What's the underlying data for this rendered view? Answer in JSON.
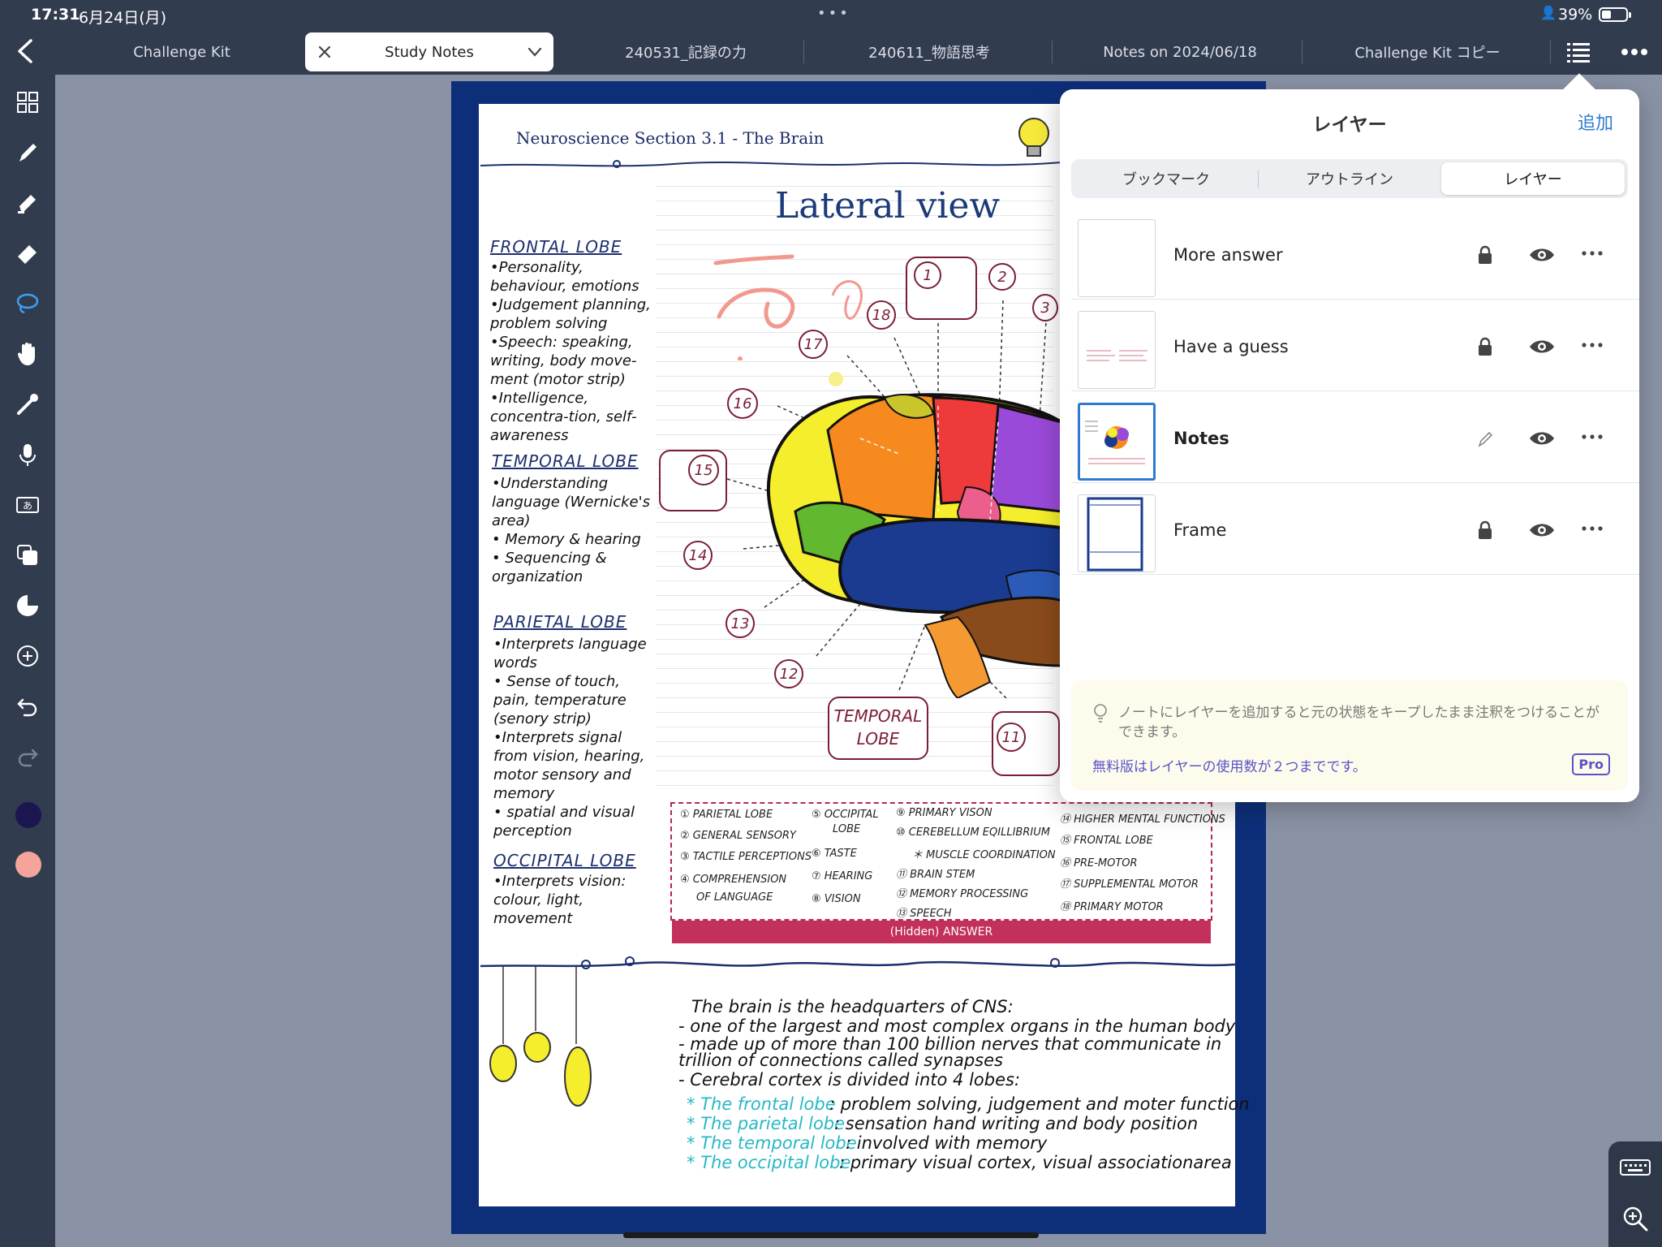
{
  "status": {
    "time": "17:31",
    "date": "6月24日(月)",
    "battery_pct": "39%",
    "battery_level": 0.39
  },
  "tabs": [
    {
      "label": "Challenge Kit"
    },
    {
      "label": "Study Notes"
    },
    {
      "label": "240531_記録の力"
    },
    {
      "label": "240611_物語思考"
    },
    {
      "label": "Notes on 2024/06/18"
    },
    {
      "label": "Challenge Kit コピー"
    }
  ],
  "document": {
    "header": "Neuroscience Section 3.1 - The Brain",
    "diagram_title": "Lateral view",
    "sidebar": {
      "frontal_heading": "FRONTAL LOBE",
      "frontal_items": [
        "•Personality, behaviour, emotions",
        "•Judgement planning, problem solving",
        "•Speech: speaking, writing, body move-ment (motor strip)",
        "•Intelligence, concentra-tion, self-awareness"
      ],
      "temporal_heading": "TEMPORAL LOBE",
      "temporal_items": [
        "•Understanding language (Wernicke's area)",
        "• Memory & hearing",
        "• Sequencing & organization"
      ],
      "parietal_heading": "PARIETAL LOBE",
      "parietal_items": [
        "•Interprets language words",
        "• Sense of touch, pain, temperature (senory strip)",
        "•Interprets signal from vision, hearing, motor sensory and memory",
        "• spatial and visual perception"
      ],
      "occipital_heading": "OCCIPITAL LOBE",
      "occipital_items": [
        "•Interprets vision: colour, light, movement"
      ]
    },
    "labels": [
      "1",
      "2",
      "3",
      "11",
      "12",
      "13",
      "14",
      "15",
      "16",
      "17",
      "18"
    ],
    "temporal_box": [
      "TEMPORAL",
      "LOBE"
    ],
    "answers": {
      "col1": [
        "① PARIETAL LOBE",
        "② GENERAL SENSORY",
        "③ TACTILE PERCEPTIONS",
        "④ COMPREHENSION",
        "OF LANGUAGE"
      ],
      "col2": [
        "⑤ OCCIPITAL",
        "LOBE",
        "⑥ TASTE",
        "⑦ HEARING",
        "⑧ VISION"
      ],
      "col3": [
        "⑨ PRIMARY VISON",
        "⑩ CEREBELLUM EQILLIBRIUM",
        "＊ MUSCLE COORDINATION",
        "⑪ BRAIN STEM",
        "⑫ MEMORY PROCESSING",
        "⑬ SPEECH"
      ],
      "col4": [
        "⑭ HIGHER MENTAL FUNCTIONS",
        "⑮ FRONTAL LOBE",
        "⑯ PRE-MOTOR",
        "⑰ SUPPLEMENTAL MOTOR",
        "⑱ PRIMARY MOTOR"
      ],
      "hidden_label": "(Hidden) ANSWER"
    },
    "bottom": {
      "lines": [
        "The brain is the headquarters of CNS:",
        "- one of the largest and most complex organs in the human body",
        "- made up of more than 100 billion nerves that communicate in",
        "  trillion of connections called synapses",
        "- Cerebral cortex is divided into 4 lobes:"
      ],
      "lobes": [
        {
          "name": "* The frontal lobe",
          "desc": ": problem solving, judgement and moter function"
        },
        {
          "name": "* The parietal lobe",
          "desc": ": sensation hand writing and body position"
        },
        {
          "name": "* The temporal lobe",
          "desc": ": involved with memory"
        },
        {
          "name": "* The occipital lobe",
          "desc": ": primary visual cortex, visual associationarea"
        }
      ]
    }
  },
  "layers_panel": {
    "title": "レイヤー",
    "add_label": "追加",
    "segments": [
      "ブックマーク",
      "アウトライン",
      "レイヤー"
    ],
    "selected_segment": "レイヤー",
    "layers": [
      {
        "name": "More answer",
        "state": "locked"
      },
      {
        "name": "Have a guess",
        "state": "locked"
      },
      {
        "name": "Notes",
        "state": "editing"
      },
      {
        "name": "Frame",
        "state": "locked"
      }
    ],
    "tip_text": "ノートにレイヤーを追加すると元の状態をキープしたまま注釈をつけることができます。",
    "tip_link": "無料版はレイヤーの使用数が２つまでです。",
    "pro_label": "Pro"
  },
  "colors": {
    "chrome": "#323c4f",
    "accent": "#2f7ad0",
    "doc_border": "#0d2f7a",
    "swatch_dark": "#1c1650",
    "swatch_pink": "#f4a49a"
  }
}
